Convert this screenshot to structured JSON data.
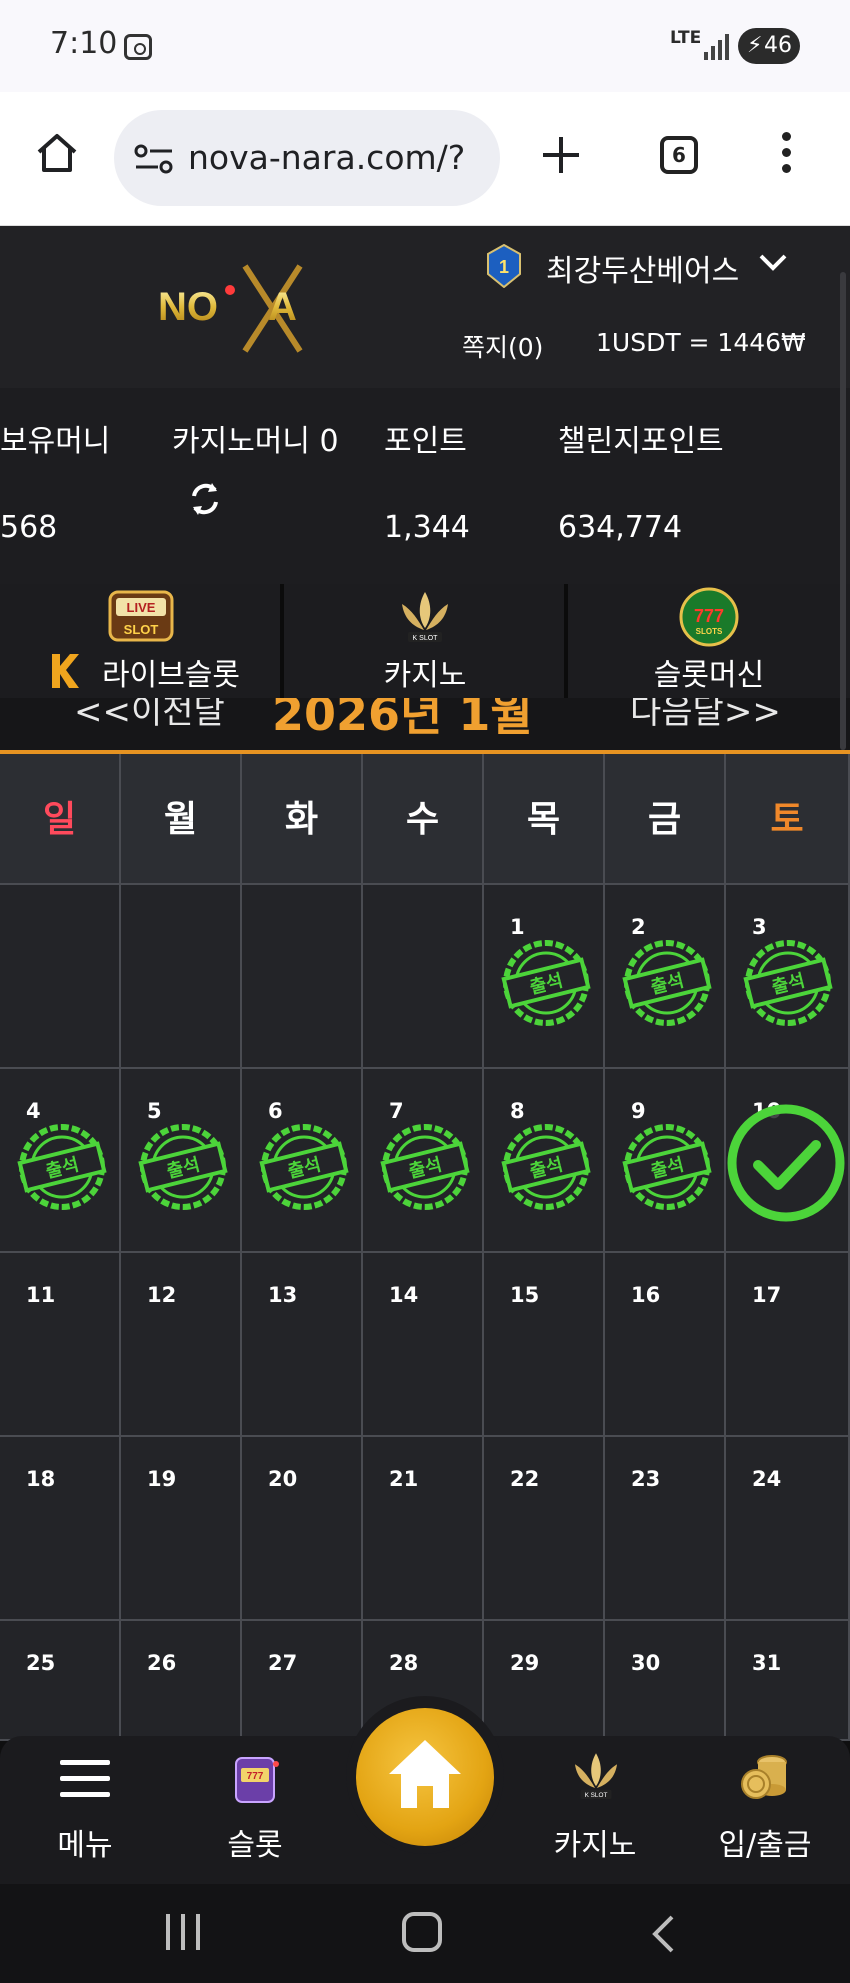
{
  "status_bar": {
    "time": "7:10",
    "network": "LTE",
    "battery": "46"
  },
  "browser": {
    "url": "nova-nara.com/?",
    "tab_count": "6"
  },
  "header": {
    "logo_text": "NOVA",
    "username": "최강두산베어스",
    "rank_badge": "1",
    "notes": "쪽지(0)",
    "rate": "1USDT = 1446₩"
  },
  "money": {
    "held_label": "보유머니",
    "held_value": "568",
    "casino_label": "카지노머니 0",
    "points_label": "포인트",
    "points_value": "1,344",
    "challenge_label": "챌린지포인트",
    "challenge_value": "634,774"
  },
  "game_nav": {
    "items": [
      {
        "label": "라이브슬롯",
        "icon_text": "LIVE SLOT"
      },
      {
        "label": "카지노",
        "icon_text": "K SLOT"
      },
      {
        "label": "슬롯머신",
        "icon_text": "SLOTS"
      }
    ]
  },
  "month_nav": {
    "prev": "<<이전달",
    "current": "2026년 1월",
    "next": "다음달>>"
  },
  "calendar": {
    "weekdays": [
      "일",
      "월",
      "화",
      "수",
      "목",
      "금",
      "토"
    ],
    "weekday_colors": [
      "#ff4a5c",
      "#ffffff",
      "#ffffff",
      "#ffffff",
      "#ffffff",
      "#ffffff",
      "#f0882a"
    ],
    "stamp_text": "출석",
    "weeks": [
      [
        null,
        null,
        null,
        null,
        {
          "d": "1",
          "s": "stamp"
        },
        {
          "d": "2",
          "s": "stamp"
        },
        {
          "d": "3",
          "s": "stamp"
        }
      ],
      [
        {
          "d": "4",
          "s": "stamp"
        },
        {
          "d": "5",
          "s": "stamp"
        },
        {
          "d": "6",
          "s": "stamp"
        },
        {
          "d": "7",
          "s": "stamp"
        },
        {
          "d": "8",
          "s": "stamp"
        },
        {
          "d": "9",
          "s": "stamp"
        },
        {
          "d": "10",
          "s": "check"
        }
      ],
      [
        {
          "d": "11"
        },
        {
          "d": "12"
        },
        {
          "d": "13"
        },
        {
          "d": "14"
        },
        {
          "d": "15"
        },
        {
          "d": "16"
        },
        {
          "d": "17"
        }
      ],
      [
        {
          "d": "18"
        },
        {
          "d": "19"
        },
        {
          "d": "20"
        },
        {
          "d": "21"
        },
        {
          "d": "22"
        },
        {
          "d": "23"
        },
        {
          "d": "24"
        }
      ],
      [
        {
          "d": "25"
        },
        {
          "d": "26"
        },
        {
          "d": "27"
        },
        {
          "d": "28"
        },
        {
          "d": "29"
        },
        {
          "d": "30"
        },
        {
          "d": "31"
        }
      ]
    ]
  },
  "bottom_nav": {
    "menu": "메뉴",
    "slot": "슬롯",
    "casino": "카지노",
    "cashier": "입/출금"
  },
  "colors": {
    "accent": "#e69322",
    "stamp": "#4cd43a"
  }
}
